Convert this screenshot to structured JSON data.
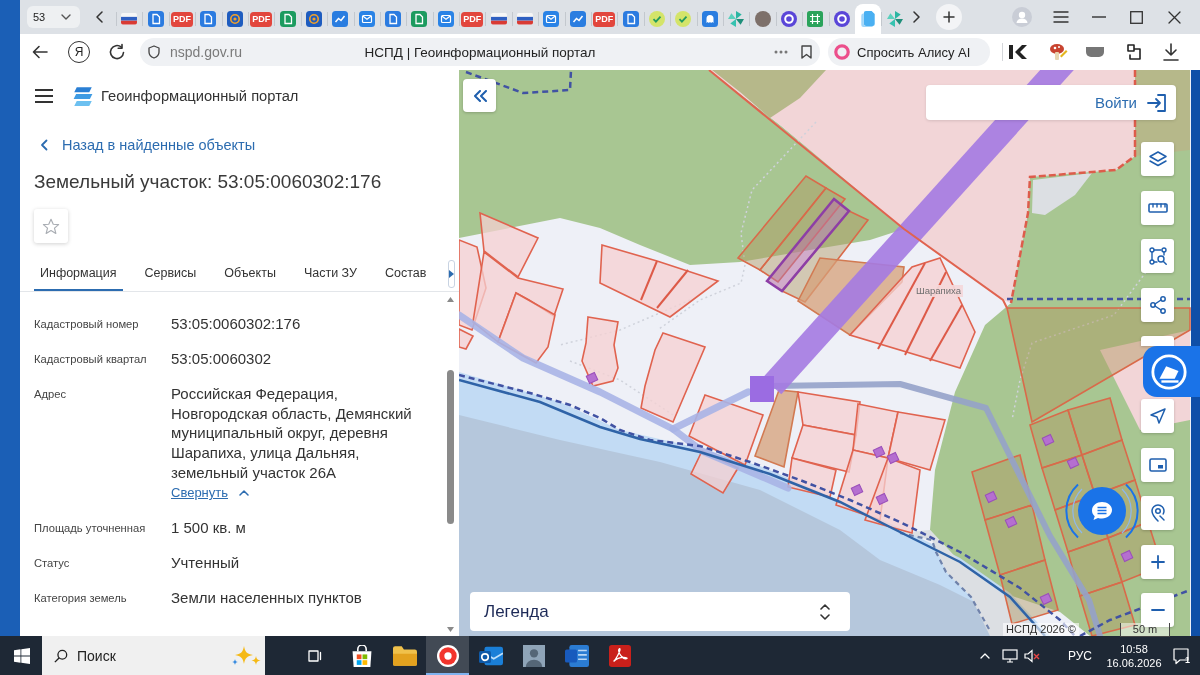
{
  "browser": {
    "tab_count": "53",
    "tabs": [
      {
        "kind": "flag",
        "selected": false
      },
      {
        "kind": "document",
        "selected": false
      },
      {
        "kind": "pdf",
        "badge": "PDF",
        "selected": false
      },
      {
        "kind": "document",
        "selected": false
      },
      {
        "kind": "at",
        "selected": false
      },
      {
        "kind": "pdf",
        "badge": "PDF",
        "selected": false
      },
      {
        "kind": "spreadsheet",
        "selected": false
      },
      {
        "kind": "at",
        "selected": false
      },
      {
        "kind": "chart",
        "selected": false
      },
      {
        "kind": "mail",
        "selected": false
      },
      {
        "kind": "document",
        "selected": false
      },
      {
        "kind": "spreadsheet",
        "selected": false
      },
      {
        "kind": "mail",
        "selected": false
      },
      {
        "kind": "pdf",
        "badge": "PDF",
        "selected": false
      },
      {
        "kind": "flag",
        "selected": false
      },
      {
        "kind": "flag",
        "selected": false
      },
      {
        "kind": "mail",
        "selected": false
      },
      {
        "kind": "chart",
        "selected": false
      },
      {
        "kind": "pdf",
        "badge": "PDF",
        "selected": false
      },
      {
        "kind": "document",
        "selected": false
      },
      {
        "kind": "check",
        "selected": false
      },
      {
        "kind": "check",
        "selected": false
      },
      {
        "kind": "chat",
        "selected": false
      },
      {
        "kind": "pinwheel",
        "selected": false
      },
      {
        "kind": "avatar",
        "selected": false
      },
      {
        "kind": "messenger",
        "selected": false
      },
      {
        "kind": "grid",
        "selected": false
      },
      {
        "kind": "messenger",
        "selected": false
      },
      {
        "kind": "page",
        "selected": true
      },
      {
        "kind": "pinwheel",
        "selected": false
      }
    ],
    "yandex_button": "Я",
    "address": "nspd.gov.ru",
    "page_title": "НСПД | Геоинформационный портал",
    "alice_button": "Спросить Алису AI"
  },
  "app_header": {
    "title": "Геоинформационный портал"
  },
  "panel": {
    "back_link": "Назад в найденные объекты",
    "title": "Земельный участок: 53:05:0060302:176",
    "starred": false,
    "tabs": [
      {
        "label": "Информация",
        "selected": true
      },
      {
        "label": "Сервисы",
        "selected": false
      },
      {
        "label": "Объекты",
        "selected": false
      },
      {
        "label": "Части ЗУ",
        "selected": false
      },
      {
        "label": "Состав",
        "selected": false
      }
    ],
    "fields": [
      {
        "label": "Кадастровый номер",
        "value": "53:05:0060302:176"
      },
      {
        "label": "Кадастровый квартал",
        "value": "53:05:0060302"
      },
      {
        "label": "Адрес",
        "value": "Российская Федерация, Новгородская область, Демянский муниципальный округ, деревня Шарапиха, улица Дальняя, земельный участок 26А",
        "toggle": "Свернуть",
        "expanded": true
      },
      {
        "label": "Площадь уточненная",
        "value": "1 500 кв. м"
      },
      {
        "label": "Статус",
        "value": "Учтенный"
      },
      {
        "label": "Категория земель",
        "value": "Земли населенных пунктов"
      }
    ]
  },
  "map": {
    "place_label": "Шарапиха",
    "login_button": "Войти",
    "legend": "Легенда",
    "attribution": "НСПД 2026 ©",
    "scale": "50 m"
  },
  "taskbar": {
    "search": {
      "placeholder": "Поиск"
    },
    "apps": [
      {
        "kind": "store",
        "selected": false
      },
      {
        "kind": "folder",
        "selected": false
      },
      {
        "kind": "yandex",
        "selected": true
      },
      {
        "kind": "outlook",
        "selected": false
      },
      {
        "kind": "photo",
        "selected": false
      },
      {
        "kind": "word",
        "selected": false
      },
      {
        "kind": "acrobat",
        "selected": false
      }
    ],
    "language": "РУС",
    "time": "10:58",
    "date": "16.06.2026",
    "notifications": "1"
  }
}
